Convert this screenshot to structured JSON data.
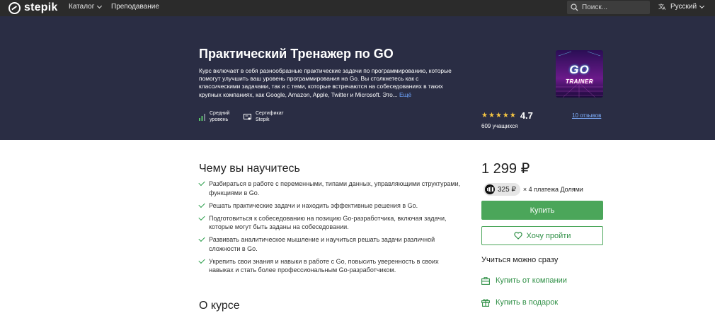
{
  "nav": {
    "logo": "stepik",
    "catalog": "Каталог",
    "teaching": "Преподавание",
    "search_placeholder": "Поиск...",
    "language": "Русский"
  },
  "course": {
    "title": "Практический Тренажер по GO",
    "description": "Курс включает в себя разнообразные практические задачи по программированию, которые помогут улучшить ваш уровень программирования на Go. Вы столкнетесь как с классическими задачами, так и с теми, которые встречаются на собеседованиях в таких крупных компаниях, как Google, Amazon, Apple, Twitter и Microsoft. Это...",
    "more": "Ещё",
    "level_line1": "Средний",
    "level_line2": "уровень",
    "cert_line1": "Сертификат",
    "cert_line2": "Stepik",
    "cover_text_top": "GO",
    "cover_text_bottom": "TRAINER",
    "stars": "★★★★★",
    "rating": "4.7",
    "students": "609 учащихся",
    "reviews": "10 отзывов"
  },
  "learn": {
    "title": "Чему вы научитесь",
    "items": [
      "Разбираться в работе с переменными, типами данных, управляющими структурами, функциями в Go.",
      "Решать практические задачи и находить эффективные решения в Go.",
      "Подготовиться к собеседованию на позицию Go-разработчика, включая задачи, которые могут быть заданы на собеседовании.",
      "Развивать аналитическое мышление и научиться решать задачи различной сложности в Go.",
      "Укрепить свои знания и навыки в работе с Go, повысить уверенность в своих навыках и стать более профессиональным Go-разработчиком."
    ]
  },
  "about": {
    "title": "О курсе"
  },
  "purchase": {
    "price": "1 299 ₽",
    "installment_amount": "325 ₽",
    "installment_text": "× 4 платежа Долями",
    "buy": "Купить",
    "wishlist": "Хочу пройти",
    "learn_now": "Учиться можно сразу",
    "buy_company": "Купить от компании",
    "buy_gift": "Купить в подарок"
  },
  "colors": {
    "nav_bg": "#2b2b2b",
    "hero_bg": "#2a2d44",
    "accent_green": "#4ba65a",
    "star": "#f5c542",
    "link_blue": "#7fb0ff"
  }
}
